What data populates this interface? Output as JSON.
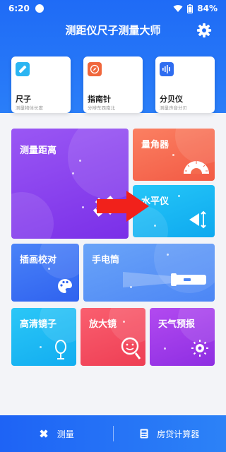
{
  "status": {
    "time": "6:20",
    "battery": "84%"
  },
  "app": {
    "title": "测距仪尺子测量大师"
  },
  "tools": [
    {
      "name": "尺子",
      "desc": "测量物体长度",
      "icon": "ruler-icon",
      "color": "#2bb5f2"
    },
    {
      "name": "指南针",
      "desc": "分辨东西南北",
      "icon": "compass-icon",
      "color": "#f0673c"
    },
    {
      "name": "分贝仪",
      "desc": "测量声音分贝",
      "icon": "sound-wave-icon",
      "color": "#2f6df0"
    }
  ],
  "tiles": {
    "distance": {
      "name": "测量距离",
      "icon": "ruler-measure-icon"
    },
    "protractor": {
      "name": "量角器",
      "icon": "protractor-icon"
    },
    "level": {
      "name": "水平仪",
      "icon": "level-icon"
    },
    "calibration": {
      "name": "插画校对",
      "icon": "palette-icon"
    },
    "flashlight": {
      "name": "手电筒",
      "icon": "flashlight-icon"
    },
    "mirror": {
      "name": "高清镜子",
      "icon": "mirror-icon"
    },
    "magnifier": {
      "name": "放大镜",
      "icon": "magnifier-icon"
    },
    "weather": {
      "name": "天气预报",
      "icon": "weather-icon"
    }
  },
  "bottom_nav": [
    {
      "label": "测量",
      "icon": "measure-icon"
    },
    {
      "label": "房贷计算器",
      "icon": "calculator-icon"
    }
  ],
  "colors": {
    "primary": "#1f6bf6",
    "purple": "#8a3cf0",
    "orange": "#f46a4e",
    "cyan": "#17b8f3",
    "red": "#f4433c",
    "pink": "#f2506e",
    "magenta": "#9f35e6"
  }
}
